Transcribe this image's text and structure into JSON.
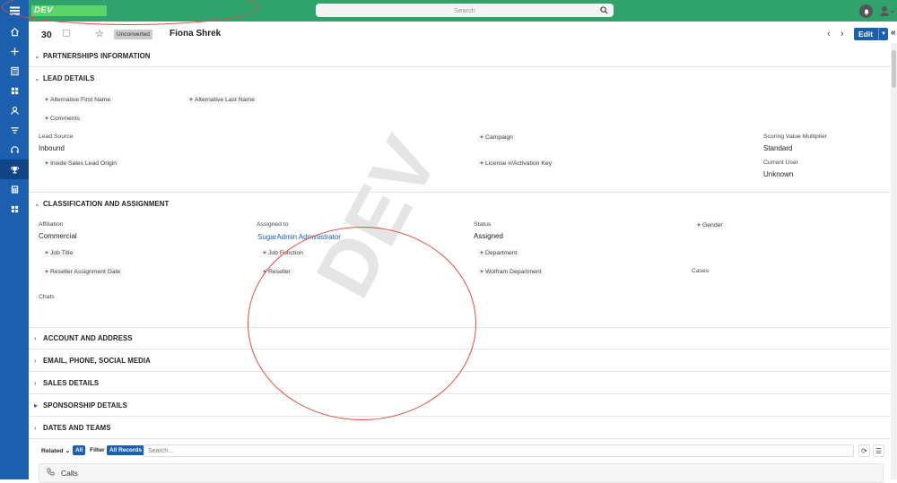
{
  "topbar": {
    "logo_text": "DEV",
    "search_placeholder": "Search"
  },
  "nav": {
    "items": [
      "menu-icon",
      "home-icon",
      "plus-icon",
      "calculator-icon",
      "grid-icon",
      "person-icon",
      "filter-icon",
      "headset-icon",
      "trophy-icon",
      "calculator-icon-2",
      "apps-icon"
    ],
    "active": "trophy-icon"
  },
  "record": {
    "number": "30",
    "status_badge": "Unconverted",
    "name": "Fiona Shrek",
    "edit_label": "Edit"
  },
  "sections": {
    "partnerships": "PARTNERSHIPS INFORMATION",
    "lead_details": "LEAD DETAILS",
    "classification": "CLASSIFICATION AND ASSIGNMENT",
    "account_address": "ACCOUNT AND ADDRESS",
    "email_phone": "EMAIL, PHONE, SOCIAL MEDIA",
    "sales": "SALES DETAILS",
    "sponsorship": "SPONSORSHIP DETAILS",
    "dates_teams": "DATES AND TEAMS"
  },
  "lead": {
    "add_alt_first": "Alternative First Name",
    "add_alt_last": "Alternative Last Name",
    "add_comments": "Comments",
    "lead_source_label": "Lead Source",
    "lead_source_value": "Inbound",
    "add_campaign": "Campaign",
    "scoring_label": "Scoring Value Multiplier",
    "scoring_value": "Standard",
    "add_inside_sales": "Inside Sales Lead Origin",
    "add_license": "License #/Activation Key",
    "current_user_label": "Current User",
    "current_user_value": "Unknown"
  },
  "classification": {
    "affiliation_label": "Affiliation",
    "affiliation_value": "Commercial",
    "assigned_label": "Assigned to",
    "assigned_value": "SugarAdmin Administrator",
    "status_label": "Status",
    "status_value": "Assigned",
    "add_gender": "Gender",
    "add_job_title": "Job Title",
    "add_job_function": "Job Function",
    "add_department": "Department",
    "add_reseller_date": "Reseller Assignment Date",
    "add_reseller": "Reseller",
    "add_wolfram_dept": "Wolfram Department",
    "cases_label": "Cases",
    "chats_label": "Chats"
  },
  "watermark": "DEV",
  "subpanel": {
    "related_label": "Related",
    "related_value": "All",
    "filter_label": "Filter",
    "filter_value": "All Records",
    "search_placeholder": "Search...",
    "calls_label": "Calls"
  }
}
